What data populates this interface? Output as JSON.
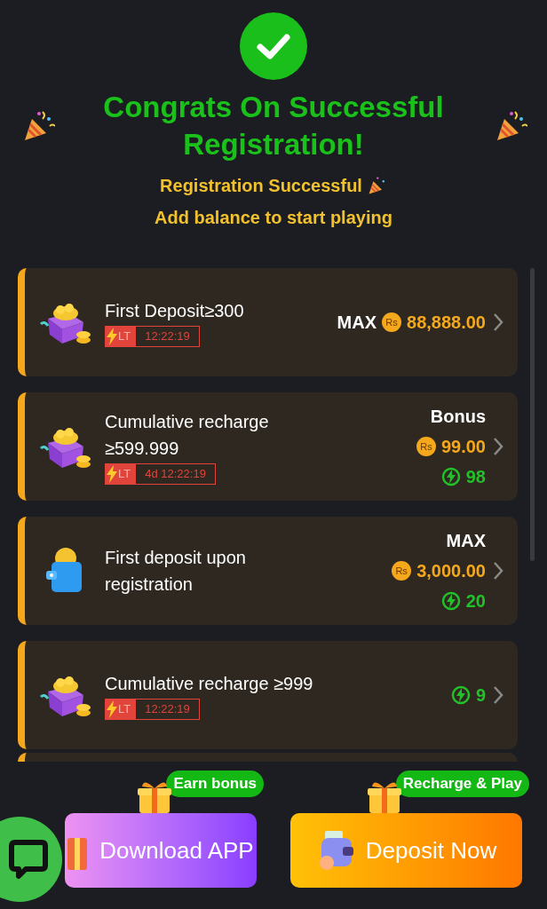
{
  "header": {
    "title": "Congrats On Successful Registration!",
    "subtitle": "Registration Successful",
    "note": "Add balance to start playing"
  },
  "offers": [
    {
      "kind": "gift",
      "title": "First Deposit≥300",
      "timer": {
        "tag": "LT",
        "time": "12:22:19"
      },
      "label": "MAX",
      "currency": "Rs",
      "amount": "88,888.00"
    },
    {
      "kind": "gift",
      "title": "Cumulative recharge ≥599.999",
      "timer": {
        "tag": "LT",
        "time": "4d 12:22:19"
      },
      "label": "Bonus",
      "currency": "Rs",
      "amount": "99.00",
      "points": "98"
    },
    {
      "kind": "wallet",
      "title": "First deposit upon registration",
      "label": "MAX",
      "currency": "Rs",
      "amount": "3,000.00",
      "points": "20"
    },
    {
      "kind": "gift",
      "title": "Cumulative recharge ≥999",
      "timer": {
        "tag": "LT",
        "time": "12:22:19"
      },
      "points": "9"
    }
  ],
  "actions": [
    {
      "kind": "download",
      "label": "Download APP",
      "tag": "Earn bonus"
    },
    {
      "kind": "deposit",
      "label": "Deposit Now",
      "tag": "Recharge & Play"
    }
  ]
}
